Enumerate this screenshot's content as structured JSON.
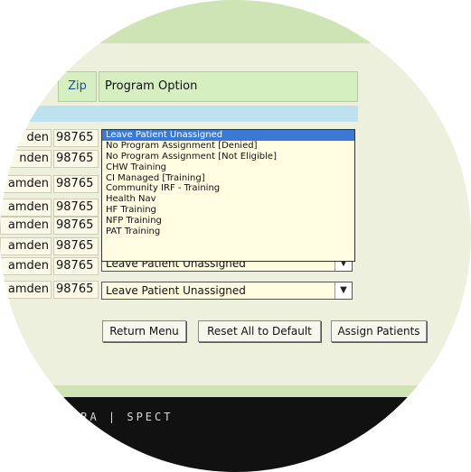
{
  "table": {
    "header": {
      "zip": "Zip",
      "program_option": "Program Option"
    },
    "rows": [
      {
        "city": "den",
        "zip": "98765"
      },
      {
        "city": "nden",
        "zip": "98765"
      },
      {
        "city": "amden",
        "zip": "98765"
      },
      {
        "city": "amden",
        "zip": "98765"
      },
      {
        "city": "amden",
        "zip": "98765"
      },
      {
        "city": "amden",
        "zip": "98765"
      },
      {
        "city": "amden",
        "zip": "98765"
      },
      {
        "city": "amden",
        "zip": "98765"
      }
    ]
  },
  "dropdown": {
    "options": [
      "Leave Patient Unassigned",
      "No Program Assignment [Denied]",
      "No Program Assignment [Not Eligible]",
      "CHW Training",
      "CI Managed [Training]",
      "Community IRF - Training",
      "Health Nav",
      "HF Training",
      "NFP Training",
      "PAT Training"
    ],
    "selected_index": 0
  },
  "selects": {
    "partial_value": "Leave Patient Unassigned",
    "last_value": "Leave Patient Unassigned"
  },
  "buttons": {
    "return_menu": "Return Menu",
    "reset_all": "Reset All to Default",
    "assign_patients": "Assign Patients"
  },
  "footer": {
    "text": "RRA | SPECT"
  },
  "colors": {
    "header_bg": "#d6efc0",
    "highlight": "#3a7ad6",
    "footer_bg": "#111111"
  }
}
